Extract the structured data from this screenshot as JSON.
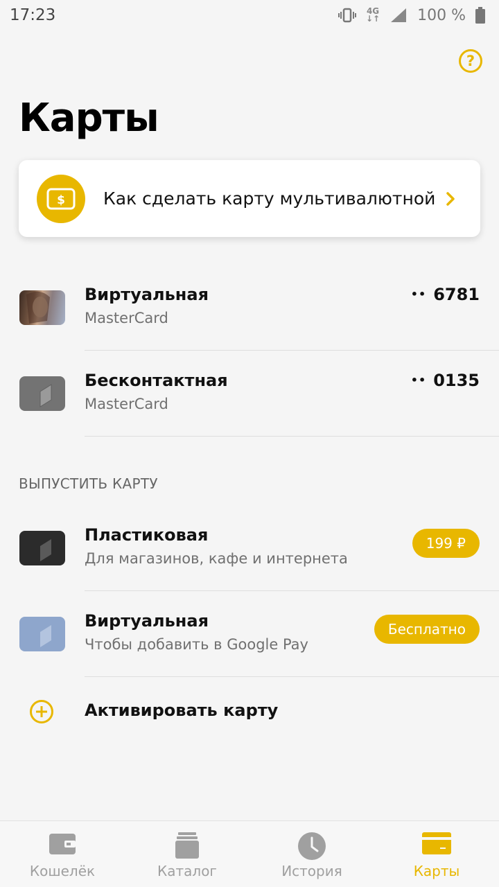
{
  "status_bar": {
    "time": "17:23",
    "network": "4G",
    "battery": "100 %"
  },
  "header": {
    "title": "Карты",
    "help_icon": "question-circle-icon"
  },
  "promo": {
    "text": "Как сделать карту мультивалютной",
    "icon": "currency-card-icon"
  },
  "cards": [
    {
      "title": "Виртуальная",
      "subtitle": "MasterCard",
      "dots": "••",
      "number": "6781"
    },
    {
      "title": "Бесконтактная",
      "subtitle": "MasterCard",
      "dots": "••",
      "number": "0135"
    }
  ],
  "issue_section": {
    "label": "ВЫПУСТИТЬ КАРТУ",
    "items": [
      {
        "title": "Пластиковая",
        "subtitle": "Для магазинов, кафе и интернета",
        "price": "199 ₽"
      },
      {
        "title": "Виртуальная",
        "subtitle": "Чтобы добавить в Google Pay",
        "price": "Бесплатно"
      }
    ],
    "activate_label": "Активировать карту"
  },
  "colors": {
    "accent": "#e8b700",
    "background": "#f5f5f5"
  },
  "nav": {
    "items": [
      {
        "label": "Кошелёк",
        "icon": "wallet-icon"
      },
      {
        "label": "Каталог",
        "icon": "catalog-icon"
      },
      {
        "label": "История",
        "icon": "clock-icon"
      },
      {
        "label": "Карты",
        "icon": "card-icon"
      }
    ],
    "active": "Карты"
  }
}
